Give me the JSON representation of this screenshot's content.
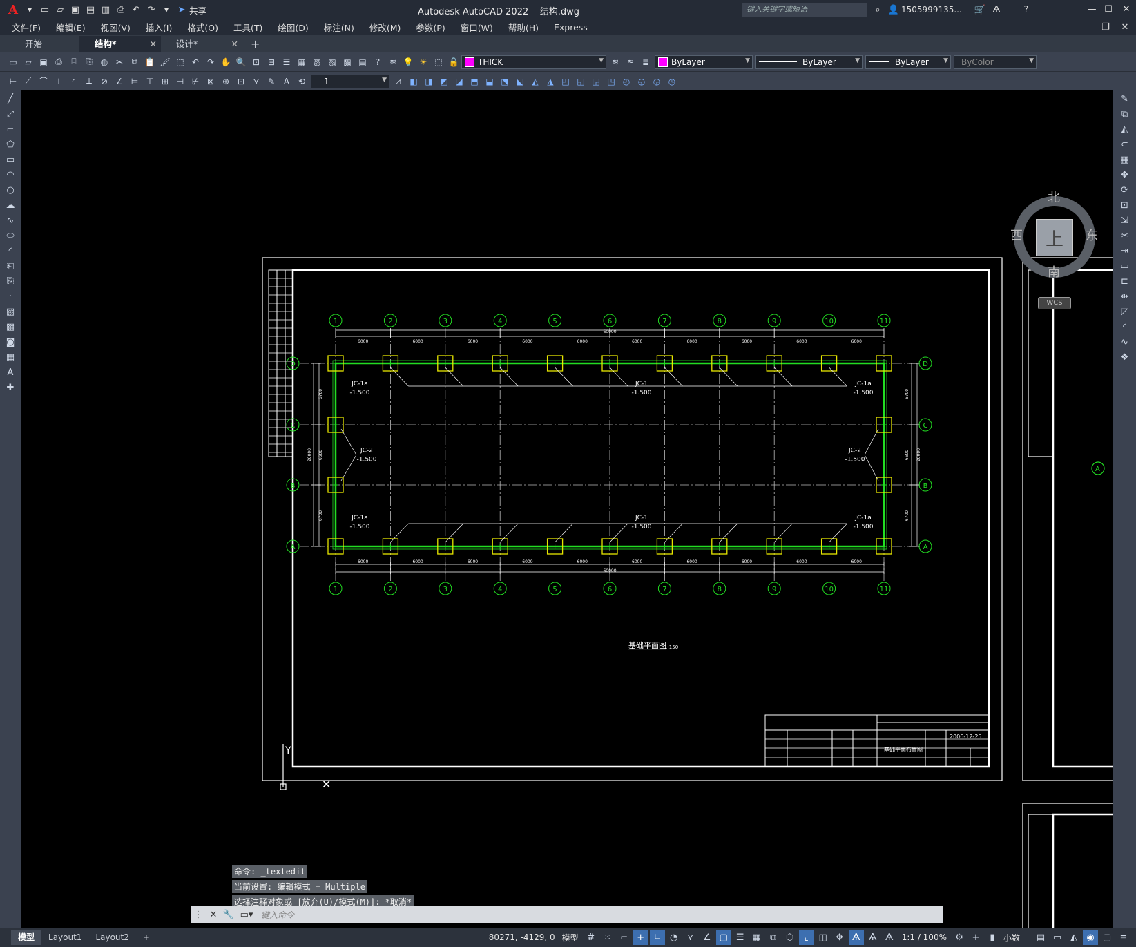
{
  "app": {
    "title": "Autodesk AutoCAD 2022",
    "filename": "结构.dwg",
    "logo": "A",
    "share_label": "共享",
    "search_placeholder": "键入关键字或短语",
    "user": "1505999135..."
  },
  "menus": [
    "文件(F)",
    "编辑(E)",
    "视图(V)",
    "插入(I)",
    "格式(O)",
    "工具(T)",
    "绘图(D)",
    "标注(N)",
    "修改(M)",
    "参数(P)",
    "窗口(W)",
    "帮助(H)",
    "Express"
  ],
  "tabs": [
    {
      "label": "开始"
    },
    {
      "label": "结构*"
    },
    {
      "label": "设计*"
    }
  ],
  "toolbar": {
    "layer": "THICK",
    "color": "ByLayer",
    "linetype": "ByLayer",
    "lineweight": "ByLayer",
    "plotstyle": "ByColor",
    "dimscale": "1"
  },
  "viewcube": {
    "north": "北",
    "south": "南",
    "east": "东",
    "west": "西",
    "top": "上",
    "wcs": "WCS"
  },
  "drawing": {
    "col_labels": [
      "1",
      "2",
      "3",
      "4",
      "5",
      "6",
      "7",
      "8",
      "9",
      "10",
      "11"
    ],
    "row_labels": [
      "D",
      "C",
      "B",
      "A"
    ],
    "span_label": "6000",
    "total_label": "60000",
    "depth_total": "20000",
    "depth_spans": [
      "6700",
      "6600",
      "6700"
    ],
    "notes": {
      "jc1a": "JC-1a",
      "jc1": "JC-1",
      "jc2": "JC-2",
      "elev": "-1.500"
    },
    "plan_title": "基础平面图",
    "plan_scale": "1:150",
    "titleblock": {
      "date": "2006-12-25",
      "drawing_name": "基础平面布置图"
    }
  },
  "command": {
    "history": [
      "命令: _textedit",
      "当前设置: 编辑模式 = Multiple",
      "选择注释对象或 [放弃(U)/模式(M)]: *取消*"
    ],
    "placeholder": "键入命令"
  },
  "status": {
    "tabs": [
      "模型",
      "Layout1",
      "Layout2"
    ],
    "coords": "80271, -4129, 0",
    "mode": "模型",
    "scale": "1:1 / 100%",
    "units": "小数"
  },
  "colors": {
    "green": "#22dd22",
    "yellow": "#e6e600",
    "grid": "#bbbbbb"
  }
}
